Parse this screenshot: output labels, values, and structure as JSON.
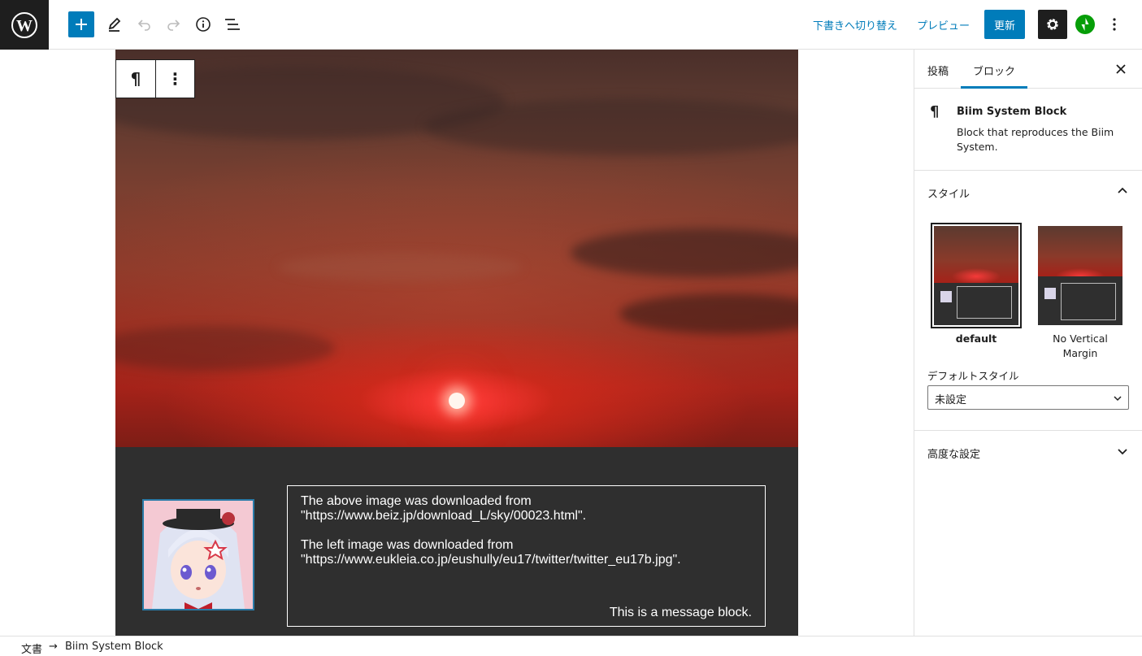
{
  "topbar": {
    "switch_to_draft": "下書きへ切り替え",
    "preview": "プレビュー",
    "update": "更新"
  },
  "content": {
    "message_line1": "The above image was downloaded from",
    "message_line2": "\"https://www.beiz.jp/download_L/sky/00023.html\".",
    "message_line3": "The left image was downloaded from",
    "message_line4": "\"https://www.eukleia.co.jp/eushully/eu17/twitter/twitter_eu17b.jpg\".",
    "message_sign": "This is a message block."
  },
  "block_toolbar": {
    "block_icon": "¶",
    "more_icon": "⋮"
  },
  "sidebar": {
    "tab_post": "投稿",
    "tab_block": "ブロック",
    "block_icon": "¶",
    "block_name": "Biim System Block",
    "block_description": "Block that reproduces the Biim System.",
    "styles_title": "スタイル",
    "style_default": "default",
    "style_no_margin": "No Vertical Margin",
    "default_style_label": "デフォルトスタイル",
    "default_style_value": "未設定",
    "advanced_title": "高度な設定"
  },
  "footer": {
    "crumb_document": "文書",
    "crumb_arrow": "→",
    "crumb_block": "Biim System Block"
  },
  "colors": {
    "accent": "#007cba",
    "dark": "#1e1e1e",
    "jetpack": "#069e08"
  }
}
